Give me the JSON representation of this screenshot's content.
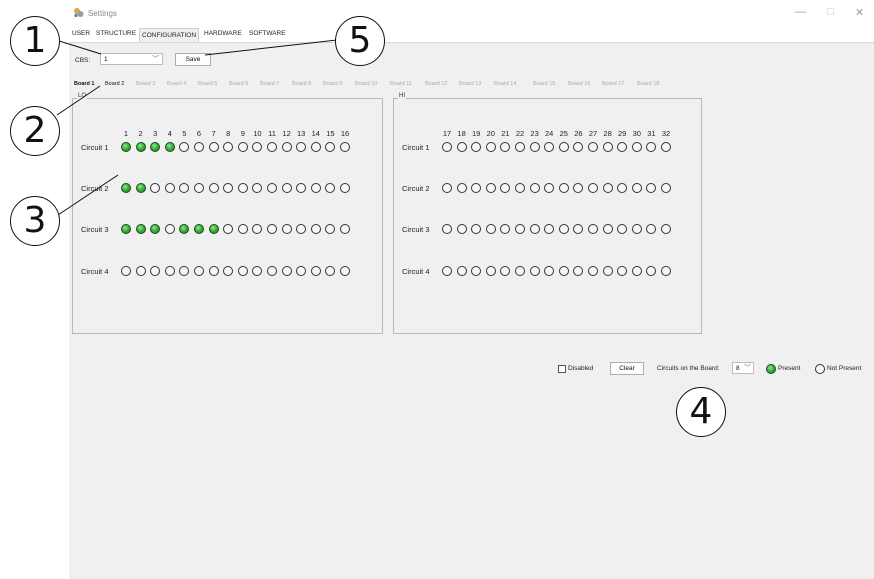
{
  "window": {
    "title": "Settings",
    "minimize_glyph": "—",
    "maximize_glyph": "▢",
    "close_glyph": "✕",
    "icon": "settings-app-icon"
  },
  "menu_tabs": [
    "USER",
    "STRUCTURE",
    "CONFIGURATION",
    "HARDWARE",
    "SOFTWARE"
  ],
  "active_menu_tab": "CONFIGURATION",
  "cbs": {
    "label": "CBS:",
    "value": "1",
    "save_label": "Save"
  },
  "board_tabs": [
    "Board 1",
    "Board 2",
    "Board 3",
    "Board 4",
    "Board 5",
    "Board 6",
    "Board 7",
    "Board 8",
    "Board 9",
    "Board 10",
    "Board 11",
    "Board 12",
    "Board 13",
    "Board 14",
    "Board 15",
    "Board 16",
    "Board 17",
    "Board 18"
  ],
  "active_board_tab": "Board 1",
  "lo": {
    "title": "LO",
    "numbers": [
      "1",
      "2",
      "3",
      "4",
      "5",
      "6",
      "7",
      "8",
      "9",
      "10",
      "11",
      "12",
      "13",
      "14",
      "15",
      "16"
    ],
    "circuits": [
      {
        "label": "Circuit 1",
        "states": [
          1,
          1,
          1,
          1,
          0,
          0,
          0,
          0,
          0,
          0,
          0,
          0,
          0,
          0,
          0,
          0
        ]
      },
      {
        "label": "Circuit 2",
        "states": [
          1,
          1,
          0,
          0,
          0,
          0,
          0,
          0,
          0,
          0,
          0,
          0,
          0,
          0,
          0,
          0
        ]
      },
      {
        "label": "Circuit 3",
        "states": [
          1,
          1,
          1,
          0,
          1,
          1,
          1,
          0,
          0,
          0,
          0,
          0,
          0,
          0,
          0,
          0
        ]
      },
      {
        "label": "Circuit 4",
        "states": [
          0,
          0,
          0,
          0,
          0,
          0,
          0,
          0,
          0,
          0,
          0,
          0,
          0,
          0,
          0,
          0
        ]
      }
    ]
  },
  "hi": {
    "title": "HI",
    "numbers": [
      "17",
      "18",
      "19",
      "20",
      "21",
      "22",
      "23",
      "24",
      "25",
      "26",
      "27",
      "28",
      "29",
      "30",
      "31",
      "32"
    ],
    "circuits": [
      {
        "label": "Circuit 1",
        "states": [
          0,
          0,
          0,
          0,
          0,
          0,
          0,
          0,
          0,
          0,
          0,
          0,
          0,
          0,
          0,
          0
        ]
      },
      {
        "label": "Circuit 2",
        "states": [
          0,
          0,
          0,
          0,
          0,
          0,
          0,
          0,
          0,
          0,
          0,
          0,
          0,
          0,
          0,
          0
        ]
      },
      {
        "label": "Circuit 3",
        "states": [
          0,
          0,
          0,
          0,
          0,
          0,
          0,
          0,
          0,
          0,
          0,
          0,
          0,
          0,
          0,
          0
        ]
      },
      {
        "label": "Circuit 4",
        "states": [
          0,
          0,
          0,
          0,
          0,
          0,
          0,
          0,
          0,
          0,
          0,
          0,
          0,
          0,
          0,
          0
        ]
      }
    ]
  },
  "controls": {
    "disabled_label": "Disabled",
    "clear_label": "Clear",
    "circuits_label": "Circuits on the Board:",
    "circuits_value": "8",
    "present_label": "Present",
    "not_present_label": "Not Present"
  },
  "callouts": [
    "1",
    "2",
    "3",
    "4",
    "5"
  ],
  "colors": {
    "led_on": "#3cb23c",
    "led_off": "#f7f7f7",
    "window_bg": "#f0f0f0"
  }
}
